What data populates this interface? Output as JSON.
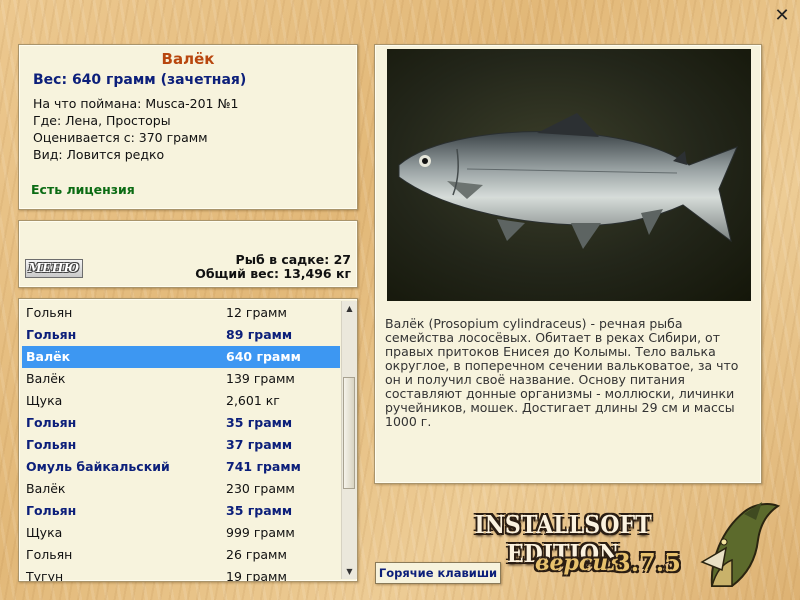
{
  "close_glyph": "✕",
  "info": {
    "name": "Валёк",
    "weight": "Вес: 640 грамм (зачетная)",
    "lines": [
      "На что поймана: Musca-201 №1",
      "Где: Лена, Просторы",
      "Оценивается с: 370 грамм",
      "Вид: Ловится редко"
    ],
    "license": "Есть лицензия"
  },
  "stats": {
    "menu_label": "МЕНЮ",
    "fish_in_net": "Рыб в садке: 27",
    "total_weight": "Общий вес: 13,496 кг"
  },
  "list": {
    "rows": [
      {
        "name": "Гольян",
        "weight": "12 грамм",
        "style": "normal"
      },
      {
        "name": "Гольян",
        "weight": "89 грамм",
        "style": "bold"
      },
      {
        "name": "Валёк",
        "weight": "640 грамм",
        "style": "selected"
      },
      {
        "name": "Валёк",
        "weight": "139 грамм",
        "style": "normal"
      },
      {
        "name": "Щука",
        "weight": "2,601 кг",
        "style": "normal"
      },
      {
        "name": "Гольян",
        "weight": "35 грамм",
        "style": "bold"
      },
      {
        "name": "Гольян",
        "weight": "37 грамм",
        "style": "bold"
      },
      {
        "name": "Омуль байкальский",
        "weight": "741 грамм",
        "style": "bold"
      },
      {
        "name": "Валёк",
        "weight": "230 грамм",
        "style": "normal"
      },
      {
        "name": "Гольян",
        "weight": "35 грамм",
        "style": "bold"
      },
      {
        "name": "Щука",
        "weight": "999 грамм",
        "style": "normal"
      },
      {
        "name": "Гольян",
        "weight": "26 грамм",
        "style": "normal"
      },
      {
        "name": "Тугун",
        "weight": "19 грамм",
        "style": "normal"
      }
    ]
  },
  "detail": {
    "description": "Валёк (Prosopium cylindraceus) - речная рыба семейства лососёвых. Обитает в реках Сибири, от правых притоков Енисея до Колымы. Тело валька округлое, в поперечном сечении вальковатое, за что он и получил своё название. Основу питания составляют донные организмы - моллюски, личинки ручейников, мошек. Достигает длины 29 см и массы 1000 г."
  },
  "hotkeys_label": "Горячие клавиши",
  "brand": {
    "edition": "INSTALLSOFT EDITION",
    "version_label": "версия",
    "version": "3.7.5"
  },
  "colors": {
    "title_orange": "#b8460e",
    "accent_blue": "#0c1f7a",
    "license_green": "#0b6b13",
    "selection": "#3d97f2"
  }
}
